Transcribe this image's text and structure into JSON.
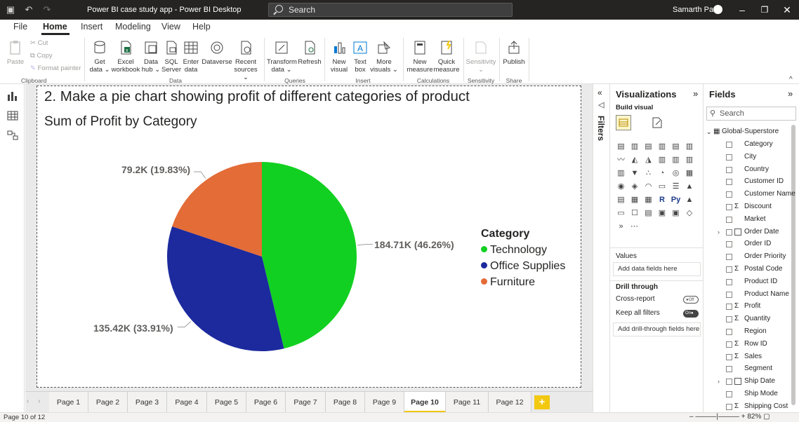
{
  "titlebar": {
    "title": "Power BI case study app - Power BI Desktop",
    "search_placeholder": "Search",
    "user": "Samarth Patil"
  },
  "menu": {
    "items": [
      "File",
      "Home",
      "Insert",
      "Modeling",
      "View",
      "Help"
    ]
  },
  "ribbon": {
    "clipboard": {
      "paste": "Paste",
      "cut": "Cut",
      "copy": "Copy",
      "format_painter": "Format painter",
      "group": "Clipboard"
    },
    "data": {
      "get_data": [
        "Get",
        "data ⌄"
      ],
      "excel": [
        "Excel",
        "workbook"
      ],
      "data_hub": [
        "Data",
        "hub ⌄"
      ],
      "sql": [
        "SQL",
        "Server"
      ],
      "enter": [
        "Enter",
        "data"
      ],
      "dataverse": [
        "Dataverse",
        ""
      ],
      "recent": [
        "Recent",
        "sources ⌄"
      ],
      "group": "Data"
    },
    "queries": {
      "transform": [
        "Transform",
        "data ⌄"
      ],
      "refresh": [
        "Refresh",
        ""
      ],
      "group": "Queries"
    },
    "insert": {
      "new_visual": [
        "New",
        "visual"
      ],
      "text_box": [
        "Text",
        "box"
      ],
      "more": [
        "More",
        "visuals ⌄"
      ],
      "group": "Insert"
    },
    "calculations": {
      "new_measure": [
        "New",
        "measure"
      ],
      "quick_measure": [
        "Quick",
        "measure"
      ],
      "group": "Calculations"
    },
    "sensitivity": {
      "label": [
        "Sensitivity",
        "⌄"
      ],
      "group": "Sensitivity"
    },
    "share": {
      "publish": [
        "Publish",
        ""
      ],
      "group": "Share"
    }
  },
  "report": {
    "heading": "2. Make a pie chart showing profit of different categories of product",
    "chart_title": "Sum of Profit by Category"
  },
  "chart_data": {
    "type": "pie",
    "title": "Sum of Profit by Category",
    "legend_title": "Category",
    "legend_position": "right",
    "slices": [
      {
        "name": "Technology",
        "value": 184.71,
        "percent": 46.26,
        "label": "184.71K (46.26%)",
        "color": "#12d021"
      },
      {
        "name": "Office Supplies",
        "value": 135.42,
        "percent": 33.91,
        "label": "135.42K (33.91%)",
        "color": "#1c2a9e"
      },
      {
        "name": "Furniture",
        "value": 79.2,
        "percent": 19.83,
        "label": "79.2K (19.83%)",
        "color": "#e36c37"
      }
    ]
  },
  "tabs": {
    "pages": [
      "Page 1",
      "Page 2",
      "Page 3",
      "Page 4",
      "Page 5",
      "Page 6",
      "Page 7",
      "Page 8",
      "Page 9",
      "Page 10",
      "Page 11",
      "Page 12"
    ],
    "active": "Page 10",
    "add": "+"
  },
  "status": {
    "page": "Page 10 of 12",
    "zoom": "82%"
  },
  "filters": {
    "label": "Filters"
  },
  "visualizations": {
    "title": "Visualizations",
    "build_visual": "Build visual",
    "values": "Values",
    "add_data": "Add data fields here",
    "drill_through": "Drill through",
    "cross_report": "Cross-report",
    "cross_state": "Off",
    "keep_filters": "Keep all filters",
    "keep_state": "On",
    "add_drill": "Add drill-through fields here"
  },
  "fields": {
    "title": "Fields",
    "search_placeholder": "Search",
    "table": "Global-Superstore",
    "items": [
      {
        "name": "Category",
        "sum": false,
        "date": false
      },
      {
        "name": "City",
        "sum": false,
        "date": false
      },
      {
        "name": "Country",
        "sum": false,
        "date": false
      },
      {
        "name": "Customer ID",
        "sum": false,
        "date": false
      },
      {
        "name": "Customer Name",
        "sum": false,
        "date": false
      },
      {
        "name": "Discount",
        "sum": true,
        "date": false
      },
      {
        "name": "Market",
        "sum": false,
        "date": false
      },
      {
        "name": "Order Date",
        "sum": false,
        "date": true
      },
      {
        "name": "Order ID",
        "sum": false,
        "date": false
      },
      {
        "name": "Order Priority",
        "sum": false,
        "date": false
      },
      {
        "name": "Postal Code",
        "sum": true,
        "date": false
      },
      {
        "name": "Product ID",
        "sum": false,
        "date": false
      },
      {
        "name": "Product Name",
        "sum": false,
        "date": false
      },
      {
        "name": "Profit",
        "sum": true,
        "date": false
      },
      {
        "name": "Quantity",
        "sum": true,
        "date": false
      },
      {
        "name": "Region",
        "sum": false,
        "date": false
      },
      {
        "name": "Row ID",
        "sum": true,
        "date": false
      },
      {
        "name": "Sales",
        "sum": true,
        "date": false
      },
      {
        "name": "Segment",
        "sum": false,
        "date": false
      },
      {
        "name": "Ship Date",
        "sum": false,
        "date": true
      },
      {
        "name": "Ship Mode",
        "sum": false,
        "date": false
      },
      {
        "name": "Shipping Cost",
        "sum": true,
        "date": false
      }
    ]
  }
}
